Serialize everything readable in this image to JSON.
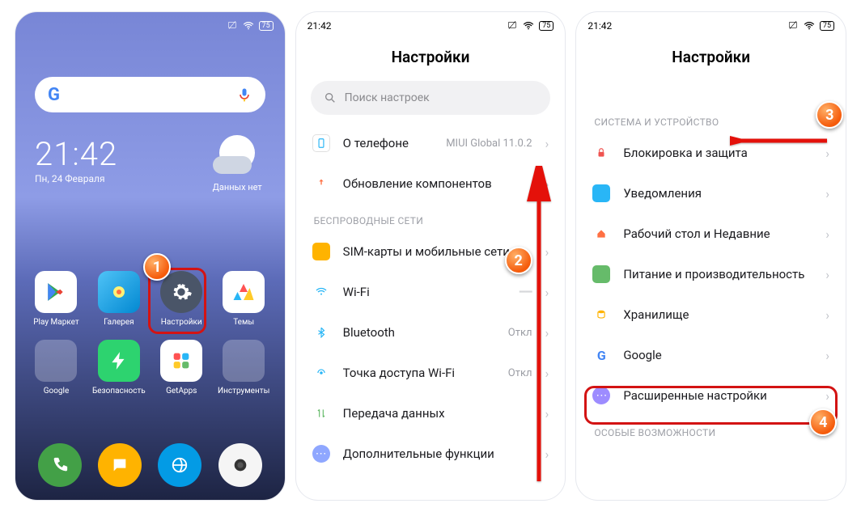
{
  "statusbar": {
    "time": "21:42",
    "battery": "75"
  },
  "home": {
    "clock": "21:42",
    "date": "Пн, 24 Февраля",
    "weather_caption": "Данных нет",
    "apps": [
      {
        "label": "Play Маркет"
      },
      {
        "label": "Галерея"
      },
      {
        "label": "Настройки"
      },
      {
        "label": "Темы"
      },
      {
        "label": "Google"
      },
      {
        "label": "Безопасность"
      },
      {
        "label": "GetApps"
      },
      {
        "label": "Инструменты"
      }
    ]
  },
  "panel2": {
    "title": "Настройки",
    "search_placeholder": "Поиск настроек",
    "about_label": "О телефоне",
    "about_value": "MIUI Global 11.0.2",
    "update_label": "Обновление компонентов",
    "section_wireless": "БЕСПРОВОДНЫЕ СЕТИ",
    "rows": {
      "sim": "SIM-карты и мобильные сети",
      "wifi": "Wi-Fi",
      "bt": "Bluetooth",
      "bt_value": "Откл",
      "hotspot": "Точка доступа Wi-Fi",
      "hotspot_value": "Откл",
      "data": "Передача данных",
      "more": "Дополнительные функции"
    }
  },
  "panel3": {
    "title": "Настройки",
    "section_system": "СИСТЕМА И УСТРОЙСТВО",
    "rows": {
      "lock": "Блокировка и защита",
      "notif": "Уведомления",
      "home": "Рабочий стол и Недавние",
      "power": "Питание и производительность",
      "storage": "Хранилище",
      "google": "Google",
      "advanced": "Расширенные настройки"
    },
    "section_special": "ОСОБЫЕ ВОЗМОЖНОСТИ"
  },
  "annotations": {
    "c1": "1",
    "c2": "2",
    "c3": "3",
    "c4": "4"
  }
}
